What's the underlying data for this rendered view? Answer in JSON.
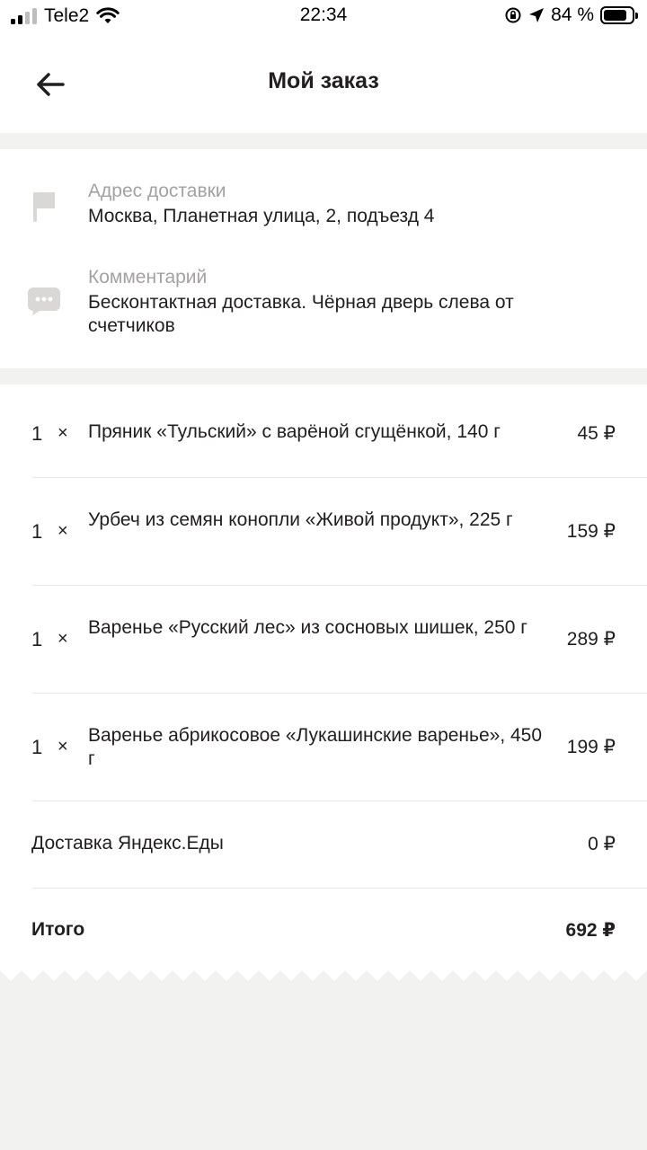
{
  "status_bar": {
    "carrier": "Tele2",
    "time": "22:34",
    "battery_percent": "84 %",
    "battery_level": 0.84
  },
  "header": {
    "title": "Мой заказ"
  },
  "delivery": {
    "address_label": "Адрес доставки",
    "address_value": "Москва, Планетная улица, 2, подъезд 4",
    "comment_label": "Комментарий",
    "comment_value": "Бесконтактная доставка. Чёрная дверь слева от счетчиков"
  },
  "items": [
    {
      "qty": "1",
      "times": "×",
      "name": "Пряник «Тульский» с варёной сгущёнкой, 140 г",
      "price": "45 ₽"
    },
    {
      "qty": "1",
      "times": "×",
      "name": "Урбеч из семян конопли «Живой продукт», 225 г",
      "price": "159 ₽"
    },
    {
      "qty": "1",
      "times": "×",
      "name": "Варенье «Русский лес» из сосновых шишек, 250 г",
      "price": "289 ₽"
    },
    {
      "qty": "1",
      "times": "×",
      "name": "Варенье абрикосовое «Лукашинские варенье», 450 г",
      "price": "199 ₽"
    }
  ],
  "summary": {
    "delivery_label": "Доставка Яндекс.Еды",
    "delivery_price": "0 ₽",
    "total_label": "Итого",
    "total_price": "692 ₽"
  },
  "colors": {
    "background": "#f2f2f0",
    "card": "#ffffff",
    "text": "#21201f",
    "secondary_text": "#a3a2a0",
    "icon_grey": "#d9d8d6"
  },
  "icons": {
    "back": "arrow-left-icon",
    "address": "flag-icon",
    "comment": "chat-bubble-icon"
  }
}
